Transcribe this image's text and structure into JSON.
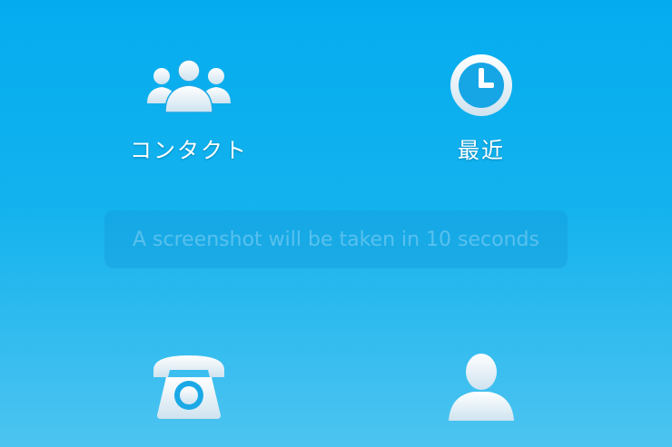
{
  "tiles": {
    "contacts": {
      "label": "コンタクト",
      "icon": "contacts-group-icon"
    },
    "recent": {
      "label": "最近",
      "icon": "clock-icon"
    },
    "phone": {
      "label": "",
      "icon": "telephone-icon"
    },
    "profile": {
      "label": "",
      "icon": "person-icon"
    }
  },
  "toast": {
    "message": "A screenshot will be taken in 10 seconds"
  },
  "colors": {
    "background_top": "#04acef",
    "background_bottom": "#4dc4f0",
    "icon_fill": "#f2f8fc",
    "icon_shade": "#cfe3ef",
    "clock_face_ring": "#1ca9e8"
  }
}
